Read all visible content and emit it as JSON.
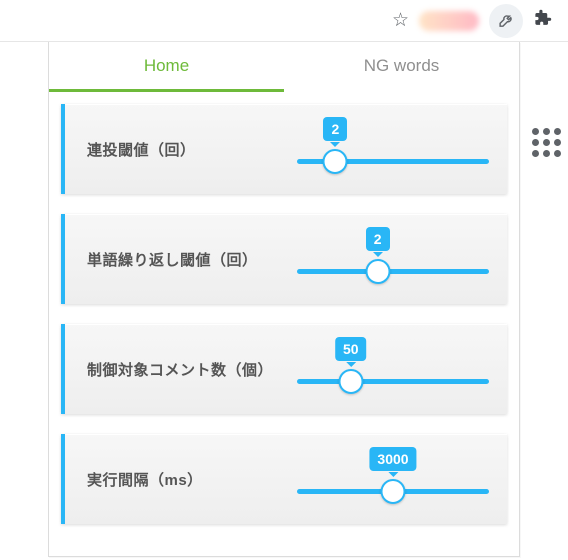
{
  "tabs": {
    "home": "Home",
    "ng": "NG words"
  },
  "sliders": [
    {
      "label": "連投閾値（回）",
      "value": "2",
      "pos": 20
    },
    {
      "label": "単語繰り返し閾値（回）",
      "value": "2",
      "pos": 42
    },
    {
      "label": "制御対象コメント数（個）",
      "value": "50",
      "pos": 28
    },
    {
      "label": "実行間隔（ms）",
      "value": "3000",
      "pos": 50
    }
  ]
}
